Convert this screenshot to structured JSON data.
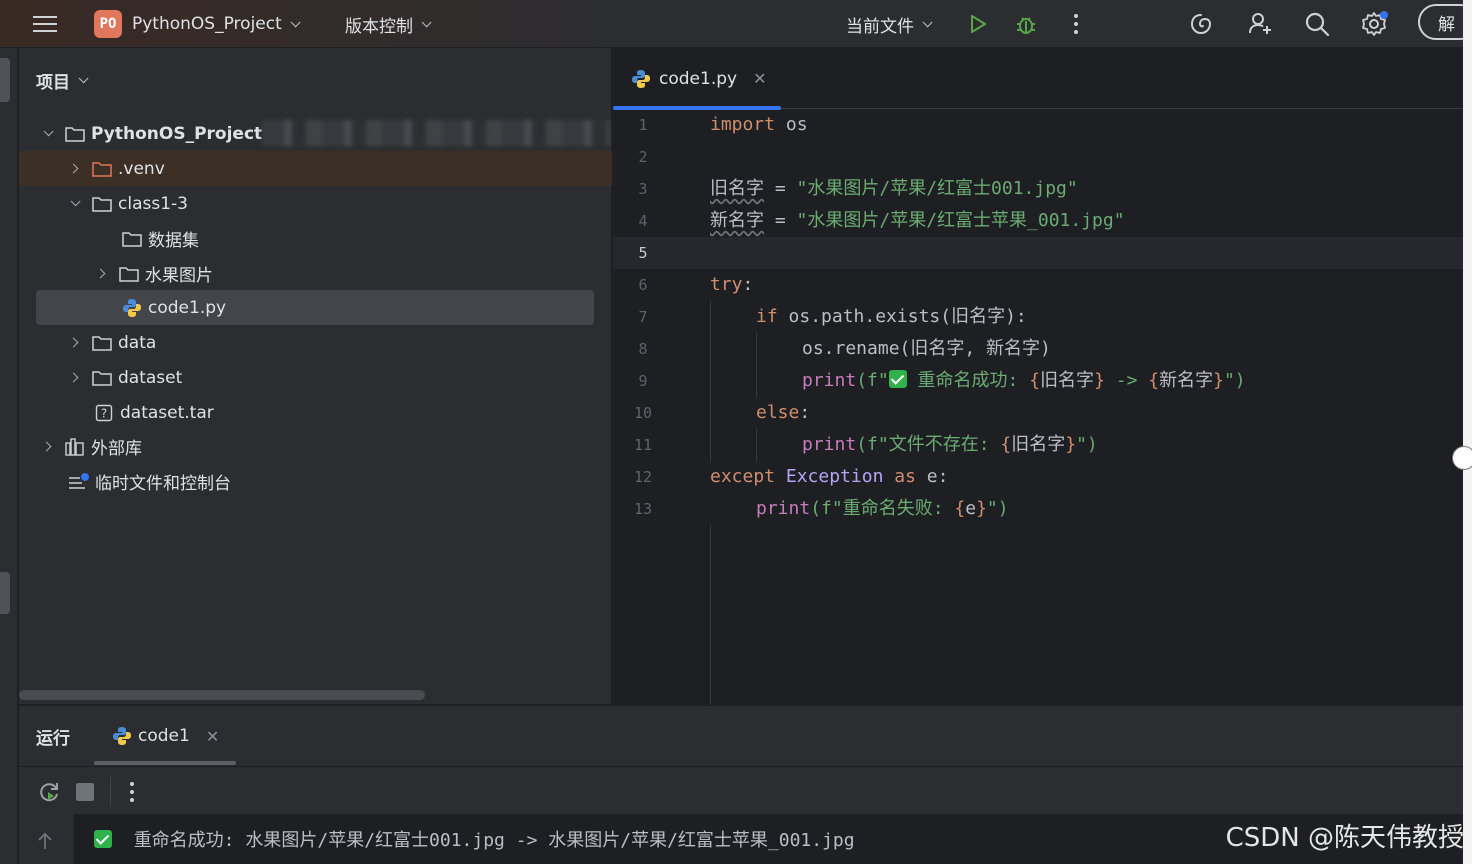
{
  "titlebar": {
    "project_badge": "PO",
    "project_name": "PythonOS_Project",
    "vcs_label": "版本控制",
    "run_config": "当前文件",
    "right_cut_label": "解"
  },
  "project_panel": {
    "title": "项目",
    "tree": [
      {
        "label": "PythonOS_Project",
        "bold": true
      },
      {
        "label": ".venv"
      },
      {
        "label": "class1-3"
      },
      {
        "label": "数据集"
      },
      {
        "label": "水果图片"
      },
      {
        "label": "code1.py"
      },
      {
        "label": "data"
      },
      {
        "label": "dataset"
      },
      {
        "label": "dataset.tar"
      },
      {
        "label": "外部库"
      },
      {
        "label": "临时文件和控制台"
      }
    ]
  },
  "editor": {
    "tab_label": "code1.py",
    "line_numbers": [
      "1",
      "2",
      "3",
      "4",
      "5",
      "6",
      "7",
      "8",
      "9",
      "10",
      "11",
      "12",
      "13"
    ],
    "current_line": 5,
    "code": {
      "l1_kw": "import",
      "l1_rest": " os",
      "l3_var": "旧名字",
      "l3_eq": " = ",
      "l3_str": "\"水果图片/苹果/红富士001.jpg\"",
      "l4_var": "新名字",
      "l4_eq": " = ",
      "l4_str": "\"水果图片/苹果/红富士苹果_001.jpg\"",
      "l6_kw": "try",
      "l6_rest": ":",
      "l7_kw": "if",
      "l7_rest": " os.path.exists(旧名字):",
      "l8_rest": "os.rename(旧名字, 新名字)",
      "l9_fn": "print",
      "l9_a": "(f\"",
      "l9_b": " 重命名成功: ",
      "l9_c": "{",
      "l9_d": "旧名字",
      "l9_e": "}",
      "l9_f": " -> ",
      "l9_g": "{",
      "l9_h": "新名字",
      "l9_i": "}",
      "l9_j": "\")",
      "l10_kw": "else",
      "l10_rest": ":",
      "l11_fn": "print",
      "l11_a": "(f\"文件不存在: ",
      "l11_b": "{",
      "l11_c": "旧名字",
      "l11_d": "}",
      "l11_e": "\")",
      "l12_kw": "except",
      "l12_cls": " Exception ",
      "l12_kw2": "as",
      "l12_rest": " e:",
      "l13_fn": "print",
      "l13_a": "(f\"重命名失败: ",
      "l13_b": "{",
      "l13_c": "e",
      "l13_d": "}",
      "l13_e": "\")"
    }
  },
  "run_panel": {
    "title": "运行",
    "tab_label": "code1",
    "console_output": "重命名成功: 水果图片/苹果/红富士001.jpg -> 水果图片/苹果/红富士苹果_001.jpg"
  },
  "watermark": "CSDN @陈天伟教授",
  "colors": {
    "accent": "#3574f0",
    "keyword": "#cf8e6d",
    "string": "#6aab73",
    "function": "#c77dbb",
    "success": "#2fb24c"
  }
}
